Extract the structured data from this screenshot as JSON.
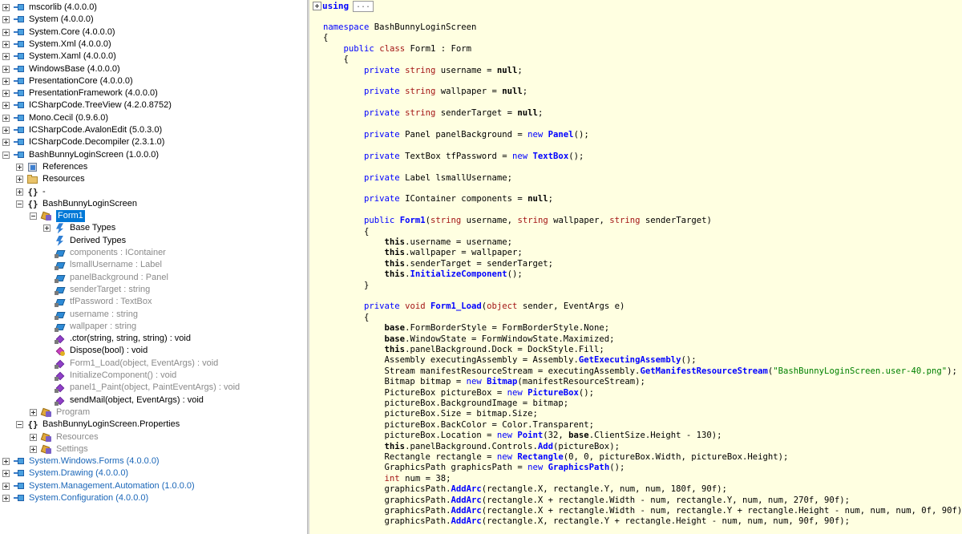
{
  "tree": {
    "items": [
      {
        "label": "mscorlib (4.0.0.0)",
        "icon": "assembly-icon",
        "expander": "plus",
        "style": "normal"
      },
      {
        "label": "System (4.0.0.0)",
        "icon": "assembly-icon",
        "expander": "plus",
        "style": "normal"
      },
      {
        "label": "System.Core (4.0.0.0)",
        "icon": "assembly-icon",
        "expander": "plus",
        "style": "normal"
      },
      {
        "label": "System.Xml (4.0.0.0)",
        "icon": "assembly-icon",
        "expander": "plus",
        "style": "normal"
      },
      {
        "label": "System.Xaml (4.0.0.0)",
        "icon": "assembly-icon",
        "expander": "plus",
        "style": "normal"
      },
      {
        "label": "WindowsBase (4.0.0.0)",
        "icon": "assembly-icon",
        "expander": "plus",
        "style": "normal"
      },
      {
        "label": "PresentationCore (4.0.0.0)",
        "icon": "assembly-icon",
        "expander": "plus",
        "style": "normal"
      },
      {
        "label": "PresentationFramework (4.0.0.0)",
        "icon": "assembly-icon",
        "expander": "plus",
        "style": "normal"
      },
      {
        "label": "ICSharpCode.TreeView (4.2.0.8752)",
        "icon": "assembly-icon",
        "expander": "plus",
        "style": "normal"
      },
      {
        "label": "Mono.Cecil (0.9.6.0)",
        "icon": "assembly-icon",
        "expander": "plus",
        "style": "normal"
      },
      {
        "label": "ICSharpCode.AvalonEdit (5.0.3.0)",
        "icon": "assembly-icon",
        "expander": "plus",
        "style": "normal"
      },
      {
        "label": "ICSharpCode.Decompiler (2.3.1.0)",
        "icon": "assembly-icon",
        "expander": "plus",
        "style": "normal"
      },
      {
        "label": "BashBunnyLoginScreen (1.0.0.0)",
        "icon": "assembly-icon",
        "expander": "minus",
        "style": "normal"
      },
      {
        "label": "References",
        "icon": "references-icon",
        "expander": "plus",
        "style": "normal"
      },
      {
        "label": "Resources",
        "icon": "folder-icon",
        "expander": "plus",
        "style": "normal"
      },
      {
        "label": "-",
        "icon": "namespace-icon",
        "expander": "plus",
        "style": "normal"
      },
      {
        "label": "BashBunnyLoginScreen",
        "icon": "namespace-icon",
        "expander": "minus",
        "style": "normal"
      },
      {
        "label": "Form1",
        "icon": "class-icon",
        "expander": "minus",
        "style": "selected"
      },
      {
        "label": "Base Types",
        "icon": "base-types-icon",
        "expander": "plus",
        "style": "normal"
      },
      {
        "label": "Derived Types",
        "icon": "derived-types-icon",
        "expander": "none",
        "style": "normal"
      },
      {
        "label": "components : IContainer",
        "icon": "field-icon",
        "expander": "none",
        "style": "gray"
      },
      {
        "label": "lsmallUsername : Label",
        "icon": "field-icon",
        "expander": "none",
        "style": "gray"
      },
      {
        "label": "panelBackground : Panel",
        "icon": "field-icon",
        "expander": "none",
        "style": "gray"
      },
      {
        "label": "senderTarget : string",
        "icon": "field-icon",
        "expander": "none",
        "style": "gray"
      },
      {
        "label": "tfPassword : TextBox",
        "icon": "field-icon",
        "expander": "none",
        "style": "gray"
      },
      {
        "label": "username : string",
        "icon": "field-icon",
        "expander": "none",
        "style": "gray"
      },
      {
        "label": "wallpaper : string",
        "icon": "field-icon",
        "expander": "none",
        "style": "gray"
      },
      {
        "label": ".ctor(string, string, string) : void",
        "icon": "method-icon",
        "expander": "none",
        "style": "normal"
      },
      {
        "label": "Dispose(bool) : void",
        "icon": "protected-method-icon",
        "expander": "none",
        "style": "normal"
      },
      {
        "label": "Form1_Load(object, EventArgs) : void",
        "icon": "method-icon",
        "expander": "none",
        "style": "gray"
      },
      {
        "label": "InitializeComponent() : void",
        "icon": "method-icon",
        "expander": "none",
        "style": "gray"
      },
      {
        "label": "panel1_Paint(object, PaintEventArgs) : void",
        "icon": "method-icon",
        "expander": "none",
        "style": "gray"
      },
      {
        "label": "sendMail(object, EventArgs) : void",
        "icon": "method-icon",
        "expander": "none",
        "style": "normal"
      },
      {
        "label": "Program",
        "icon": "class-icon",
        "expander": "plus",
        "style": "gray"
      },
      {
        "label": "BashBunnyLoginScreen.Properties",
        "icon": "namespace-icon",
        "expander": "minus",
        "style": "normal"
      },
      {
        "label": "Resources",
        "icon": "class-icon",
        "expander": "plus",
        "style": "gray"
      },
      {
        "label": "Settings",
        "icon": "class-icon",
        "expander": "plus",
        "style": "gray"
      },
      {
        "label": "System.Windows.Forms (4.0.0.0)",
        "icon": "assembly-icon",
        "expander": "plus",
        "style": "blue"
      },
      {
        "label": "System.Drawing (4.0.0.0)",
        "icon": "assembly-icon",
        "expander": "plus",
        "style": "blue"
      },
      {
        "label": "System.Management.Automation (1.0.0.0)",
        "icon": "assembly-icon",
        "expander": "plus",
        "style": "blue"
      },
      {
        "label": "System.Configuration (4.0.0.0)",
        "icon": "assembly-icon",
        "expander": "plus",
        "style": "blue"
      }
    ]
  },
  "editor": {
    "using_keyword": "using",
    "using_collapsed": "...",
    "lines": [
      [
        [
          "kw",
          "namespace"
        ],
        [
          "p",
          " BashBunnyLoginScreen"
        ]
      ],
      [
        [
          "p",
          "{"
        ]
      ],
      [
        [
          "p",
          "    "
        ],
        [
          "kw",
          "public"
        ],
        [
          "p",
          " "
        ],
        [
          "tp",
          "class"
        ],
        [
          "p",
          " Form1 : Form"
        ]
      ],
      [
        [
          "p",
          "    {"
        ]
      ],
      [
        [
          "p",
          "        "
        ],
        [
          "kw",
          "private"
        ],
        [
          "p",
          " "
        ],
        [
          "tp",
          "string"
        ],
        [
          "p",
          " username = "
        ],
        [
          "bd",
          "null"
        ],
        [
          "p",
          ";"
        ]
      ],
      [
        [
          "p",
          ""
        ]
      ],
      [
        [
          "p",
          "        "
        ],
        [
          "kw",
          "private"
        ],
        [
          "p",
          " "
        ],
        [
          "tp",
          "string"
        ],
        [
          "p",
          " wallpaper = "
        ],
        [
          "bd",
          "null"
        ],
        [
          "p",
          ";"
        ]
      ],
      [
        [
          "p",
          ""
        ]
      ],
      [
        [
          "p",
          "        "
        ],
        [
          "kw",
          "private"
        ],
        [
          "p",
          " "
        ],
        [
          "tp",
          "string"
        ],
        [
          "p",
          " senderTarget = "
        ],
        [
          "bd",
          "null"
        ],
        [
          "p",
          ";"
        ]
      ],
      [
        [
          "p",
          ""
        ]
      ],
      [
        [
          "p",
          "        "
        ],
        [
          "kw",
          "private"
        ],
        [
          "p",
          " Panel panelBackground = "
        ],
        [
          "kw",
          "new"
        ],
        [
          "p",
          " "
        ],
        [
          "fn",
          "Panel"
        ],
        [
          "p",
          "();"
        ]
      ],
      [
        [
          "p",
          ""
        ]
      ],
      [
        [
          "p",
          "        "
        ],
        [
          "kw",
          "private"
        ],
        [
          "p",
          " TextBox tfPassword = "
        ],
        [
          "kw",
          "new"
        ],
        [
          "p",
          " "
        ],
        [
          "fn",
          "TextBox"
        ],
        [
          "p",
          "();"
        ]
      ],
      [
        [
          "p",
          ""
        ]
      ],
      [
        [
          "p",
          "        "
        ],
        [
          "kw",
          "private"
        ],
        [
          "p",
          " Label lsmallUsername;"
        ]
      ],
      [
        [
          "p",
          ""
        ]
      ],
      [
        [
          "p",
          "        "
        ],
        [
          "kw",
          "private"
        ],
        [
          "p",
          " IContainer components = "
        ],
        [
          "bd",
          "null"
        ],
        [
          "p",
          ";"
        ]
      ],
      [
        [
          "p",
          ""
        ]
      ],
      [
        [
          "p",
          "        "
        ],
        [
          "kw",
          "public"
        ],
        [
          "p",
          " "
        ],
        [
          "fn",
          "Form1"
        ],
        [
          "p",
          "("
        ],
        [
          "tp",
          "string"
        ],
        [
          "p",
          " username, "
        ],
        [
          "tp",
          "string"
        ],
        [
          "p",
          " wallpaper, "
        ],
        [
          "tp",
          "string"
        ],
        [
          "p",
          " senderTarget)"
        ]
      ],
      [
        [
          "p",
          "        {"
        ]
      ],
      [
        [
          "p",
          "            "
        ],
        [
          "bd",
          "this"
        ],
        [
          "p",
          ".username = username;"
        ]
      ],
      [
        [
          "p",
          "            "
        ],
        [
          "bd",
          "this"
        ],
        [
          "p",
          ".wallpaper = wallpaper;"
        ]
      ],
      [
        [
          "p",
          "            "
        ],
        [
          "bd",
          "this"
        ],
        [
          "p",
          ".senderTarget = senderTarget;"
        ]
      ],
      [
        [
          "p",
          "            "
        ],
        [
          "bd",
          "this"
        ],
        [
          "p",
          "."
        ],
        [
          "fn",
          "InitializeComponent"
        ],
        [
          "p",
          "();"
        ]
      ],
      [
        [
          "p",
          "        }"
        ]
      ],
      [
        [
          "p",
          ""
        ]
      ],
      [
        [
          "p",
          "        "
        ],
        [
          "kw",
          "private"
        ],
        [
          "p",
          " "
        ],
        [
          "tp",
          "void"
        ],
        [
          "p",
          " "
        ],
        [
          "fn",
          "Form1_Load"
        ],
        [
          "p",
          "("
        ],
        [
          "tp",
          "object"
        ],
        [
          "p",
          " sender, EventArgs e)"
        ]
      ],
      [
        [
          "p",
          "        {"
        ]
      ],
      [
        [
          "p",
          "            "
        ],
        [
          "bd",
          "base"
        ],
        [
          "p",
          ".FormBorderStyle = FormBorderStyle.None;"
        ]
      ],
      [
        [
          "p",
          "            "
        ],
        [
          "bd",
          "base"
        ],
        [
          "p",
          ".WindowState = FormWindowState.Maximized;"
        ]
      ],
      [
        [
          "p",
          "            "
        ],
        [
          "bd",
          "this"
        ],
        [
          "p",
          ".panelBackground.Dock = DockStyle.Fill;"
        ]
      ],
      [
        [
          "p",
          "            Assembly executingAssembly = Assembly."
        ],
        [
          "fn",
          "GetExecutingAssembly"
        ],
        [
          "p",
          "();"
        ]
      ],
      [
        [
          "p",
          "            Stream manifestResourceStream = executingAssembly."
        ],
        [
          "fn",
          "GetManifestResourceStream"
        ],
        [
          "p",
          "("
        ],
        [
          "str",
          "\"BashBunnyLoginScreen.user-40.png\""
        ],
        [
          "p",
          ");"
        ]
      ],
      [
        [
          "p",
          "            Bitmap bitmap = "
        ],
        [
          "kw",
          "new"
        ],
        [
          "p",
          " "
        ],
        [
          "fn",
          "Bitmap"
        ],
        [
          "p",
          "(manifestResourceStream);"
        ]
      ],
      [
        [
          "p",
          "            PictureBox pictureBox = "
        ],
        [
          "kw",
          "new"
        ],
        [
          "p",
          " "
        ],
        [
          "fn",
          "PictureBox"
        ],
        [
          "p",
          "();"
        ]
      ],
      [
        [
          "p",
          "            pictureBox.BackgroundImage = bitmap;"
        ]
      ],
      [
        [
          "p",
          "            pictureBox.Size = bitmap.Size;"
        ]
      ],
      [
        [
          "p",
          "            pictureBox.BackColor = Color.Transparent;"
        ]
      ],
      [
        [
          "p",
          "            pictureBox.Location = "
        ],
        [
          "kw",
          "new"
        ],
        [
          "p",
          " "
        ],
        [
          "fn",
          "Point"
        ],
        [
          "p",
          "(32, "
        ],
        [
          "bd",
          "base"
        ],
        [
          "p",
          ".ClientSize.Height - 130);"
        ]
      ],
      [
        [
          "p",
          "            "
        ],
        [
          "bd",
          "this"
        ],
        [
          "p",
          ".panelBackground.Controls."
        ],
        [
          "fn",
          "Add"
        ],
        [
          "p",
          "(pictureBox);"
        ]
      ],
      [
        [
          "p",
          "            Rectangle rectangle = "
        ],
        [
          "kw",
          "new"
        ],
        [
          "p",
          " "
        ],
        [
          "fn",
          "Rectangle"
        ],
        [
          "p",
          "(0, 0, pictureBox.Width, pictureBox.Height);"
        ]
      ],
      [
        [
          "p",
          "            GraphicsPath graphicsPath = "
        ],
        [
          "kw",
          "new"
        ],
        [
          "p",
          " "
        ],
        [
          "fn",
          "GraphicsPath"
        ],
        [
          "p",
          "();"
        ]
      ],
      [
        [
          "p",
          "            "
        ],
        [
          "tp",
          "int"
        ],
        [
          "p",
          " num = 38;"
        ]
      ],
      [
        [
          "p",
          "            graphicsPath."
        ],
        [
          "fn",
          "AddArc"
        ],
        [
          "p",
          "(rectangle.X, rectangle.Y, num, num, 180f, 90f);"
        ]
      ],
      [
        [
          "p",
          "            graphicsPath."
        ],
        [
          "fn",
          "AddArc"
        ],
        [
          "p",
          "(rectangle.X + rectangle.Width - num, rectangle.Y, num, num, 270f, 90f);"
        ]
      ],
      [
        [
          "p",
          "            graphicsPath."
        ],
        [
          "fn",
          "AddArc"
        ],
        [
          "p",
          "(rectangle.X + rectangle.Width - num, rectangle.Y + rectangle.Height - num, num, num, 0f, 90f);"
        ]
      ],
      [
        [
          "p",
          "            graphicsPath."
        ],
        [
          "fn",
          "AddArc"
        ],
        [
          "p",
          "(rectangle.X, rectangle.Y + rectangle.Height - num, num, num, 90f, 90f);"
        ]
      ]
    ]
  }
}
